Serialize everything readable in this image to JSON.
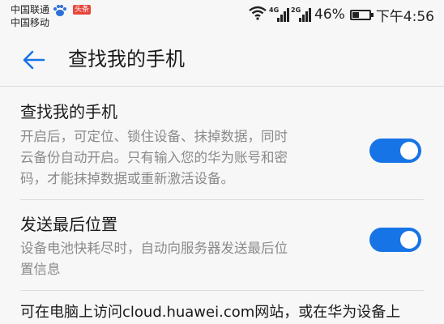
{
  "status_bar": {
    "carrier_1": "中国联通",
    "carrier_2": "中国移动",
    "toutiao_badge": "头条",
    "signal_1_tag": "4G",
    "signal_2_tag": "2G",
    "battery_percent": "46%",
    "battery_level": 0.46,
    "time": "下午4:56",
    "icons": [
      "paw-icon",
      "wifi-icon",
      "signal-icon",
      "battery-icon"
    ]
  },
  "app_bar": {
    "title": "查找我的手机",
    "back_icon": "arrow-left-icon",
    "accent_color": "#1774e6"
  },
  "settings": [
    {
      "title": "查找我的手机",
      "description_lines": [
        "开启后，可定位、锁住设备、抹掉数据，同时",
        "云备份自动开启。只有输入您的华为账号和密",
        "码，才能抹掉数据或重新激活设备。"
      ],
      "toggle_on": true
    },
    {
      "title": "发送最后位置",
      "description_lines": [
        "设备电池快耗尽时，自动向服务器发送最后位",
        "置信息"
      ],
      "toggle_on": true
    }
  ],
  "footer": {
    "text": "可在电脑上访问cloud.huawei.com网站，或在华为设备上"
  }
}
